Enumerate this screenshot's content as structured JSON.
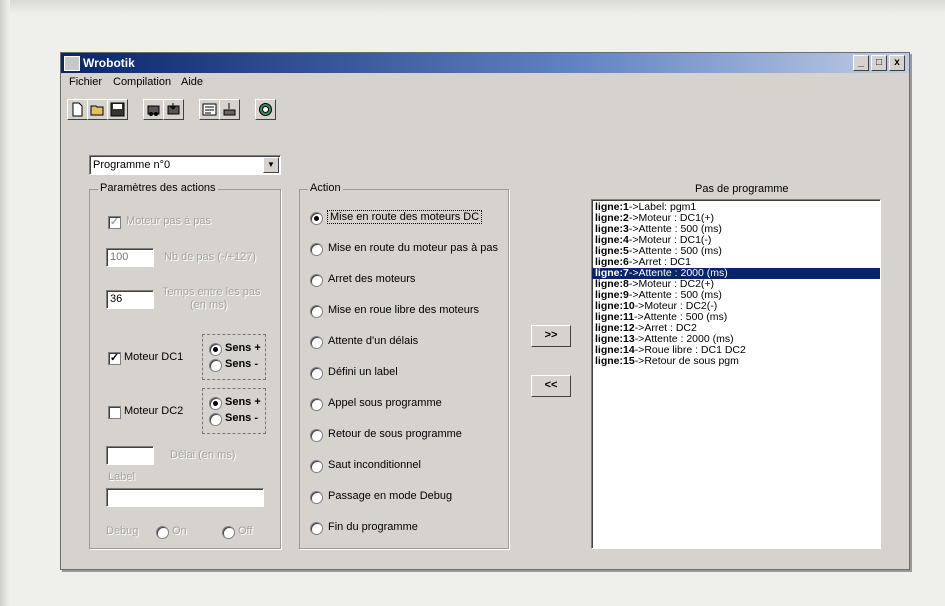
{
  "window": {
    "title": "Wrobotik",
    "min_label": "_",
    "max_label": "□",
    "close_label": "x"
  },
  "menu": {
    "items": [
      {
        "label": "Fichier"
      },
      {
        "label": "Compilation"
      },
      {
        "label": "Aide"
      }
    ]
  },
  "toolbar": {
    "buttons": [
      {
        "icon": "new-icon"
      },
      {
        "icon": "open-icon"
      },
      {
        "icon": "save-icon"
      },
      {
        "icon": "robot-load-icon"
      },
      {
        "icon": "robot-save-icon"
      },
      {
        "icon": "compile-icon"
      },
      {
        "icon": "download-icon"
      },
      {
        "icon": "help-icon"
      }
    ]
  },
  "program_select": {
    "value": "Programme n°0"
  },
  "params": {
    "legend": "Paramètres des actions",
    "step_motor_label": "Moteur pas à pas",
    "step_count_value": "100",
    "step_count_label": "Nb de pas (-/+127)",
    "step_delay_value": "36",
    "step_delay_label_1": "Temps entre les pas",
    "step_delay_label_2": "(en ms)",
    "dc1_label": "Moteur DC1",
    "dc2_label": "Moteur DC2",
    "sens_plus": "Sens +",
    "sens_minus": "Sens -",
    "delay_label": "Délai (en ms)",
    "label_caption": "Label",
    "debug_label": "Debug",
    "debug_on": "On",
    "debug_off": "Off"
  },
  "action": {
    "legend": "Action",
    "options": [
      {
        "label": "Mise en route des moteurs DC",
        "selected": true
      },
      {
        "label": "Mise en route du moteur pas à pas",
        "selected": false
      },
      {
        "label": "Arret des moteurs",
        "selected": false
      },
      {
        "label": "Mise en roue libre des moteurs",
        "selected": false
      },
      {
        "label": "Attente d'un délais",
        "selected": false
      },
      {
        "label": "Défini un label",
        "selected": false
      },
      {
        "label": "Appel sous programme",
        "selected": false
      },
      {
        "label": "Retour de sous programme",
        "selected": false
      },
      {
        "label": "Saut inconditionnel",
        "selected": false
      },
      {
        "label": "Passage en mode Debug",
        "selected": false
      },
      {
        "label": "Fin du programme",
        "selected": false
      }
    ]
  },
  "buttons": {
    "add_label": ">>",
    "remove_label": "<<"
  },
  "steps": {
    "title": "Pas de programme",
    "lines": [
      {
        "num": "ligne:1",
        "text": "->Label: pgm1",
        "selected": false
      },
      {
        "num": "ligne:2",
        "text": "->Moteur : DC1(+)",
        "selected": false
      },
      {
        "num": "ligne:3",
        "text": "->Attente : 500 (ms)",
        "selected": false
      },
      {
        "num": "ligne:4",
        "text": "->Moteur : DC1(-)",
        "selected": false
      },
      {
        "num": "ligne:5",
        "text": "->Attente : 500 (ms)",
        "selected": false
      },
      {
        "num": "ligne:6",
        "text": "->Arret : DC1",
        "selected": false
      },
      {
        "num": "ligne:7",
        "text": "->Attente : 2000 (ms)",
        "selected": true
      },
      {
        "num": "ligne:8",
        "text": "->Moteur : DC2(+)",
        "selected": false
      },
      {
        "num": "ligne:9",
        "text": "->Attente : 500 (ms)",
        "selected": false
      },
      {
        "num": "ligne:10",
        "text": "->Moteur : DC2(-)",
        "selected": false
      },
      {
        "num": "ligne:11",
        "text": "->Attente : 500 (ms)",
        "selected": false
      },
      {
        "num": "ligne:12",
        "text": "->Arret : DC2",
        "selected": false
      },
      {
        "num": "ligne:13",
        "text": "->Attente : 2000 (ms)",
        "selected": false
      },
      {
        "num": "ligne:14",
        "text": "->Roue libre : DC1 DC2",
        "selected": false
      },
      {
        "num": "ligne:15",
        "text": "->Retour de sous pgm",
        "selected": false
      }
    ]
  },
  "colors": {
    "selection": "#0a246a",
    "face": "#d6d3ce"
  }
}
